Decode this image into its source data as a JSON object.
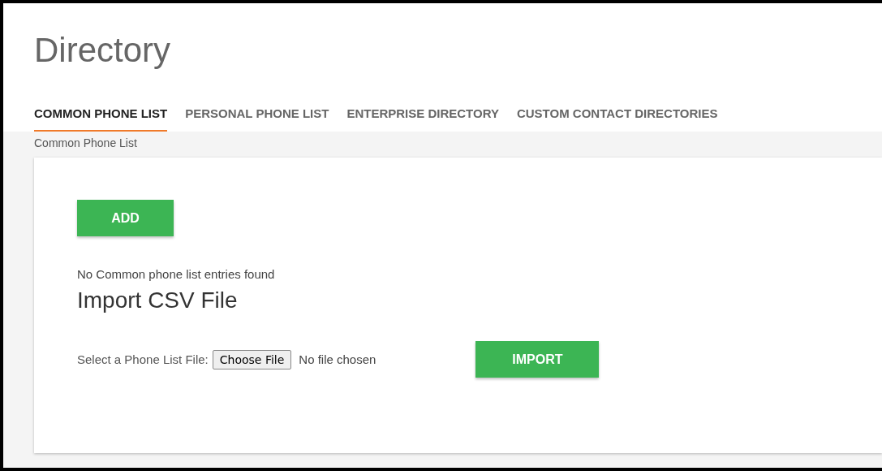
{
  "page_title": "Directory",
  "tabs": [
    {
      "label": "COMMON PHONE LIST",
      "selected": true
    },
    {
      "label": "PERSONAL PHONE LIST",
      "selected": false
    },
    {
      "label": "ENTERPRISE DIRECTORY",
      "selected": false
    },
    {
      "label": "CUSTOM CONTACT DIRECTORIES",
      "selected": false
    }
  ],
  "breadcrumb": "Common Phone List",
  "add_button": "ADD",
  "empty_message": "No Common phone list entries found",
  "import_heading": "Import CSV File",
  "file_field": {
    "label": "Select a Phone List File:",
    "button": "Choose File",
    "status": "No file chosen"
  },
  "import_button": "IMPORT"
}
